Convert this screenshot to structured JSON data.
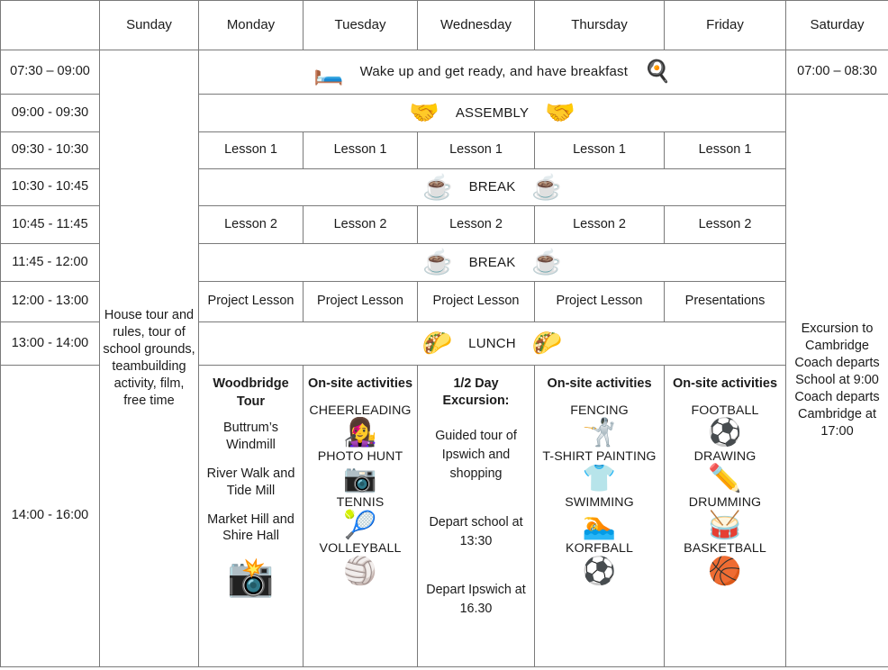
{
  "table": {
    "corner_label": "",
    "days": [
      "Sunday",
      "Monday",
      "Tuesday",
      "Wednesday",
      "Thursday",
      "Friday",
      "Saturday"
    ],
    "times": [
      "07:30 – 09:00",
      "09:00 - 09:30",
      "09:30 - 10:30",
      "10:30 - 10:45",
      "10:45 - 11:45",
      "11:45 - 12:00",
      "12:00 - 13:00",
      "13:00 - 14:00",
      "14:00 - 16:00"
    ],
    "saturday_morning_time": "07:00 – 08:30"
  },
  "rows": {
    "wakeup": {
      "text": "Wake up and get ready, and have breakfast",
      "left_icon": "person-in-bed-icon",
      "left_emoji": "🛏️",
      "right_icon": "breakfast-plate-icon",
      "right_emoji": "🍳"
    },
    "assembly": {
      "text": "ASSEMBLY",
      "left_icon": "people-group-icon",
      "left_emoji": "🤝",
      "right_icon": "people-group-icon",
      "right_emoji": "🤝"
    },
    "lesson1": [
      "Lesson 1",
      "Lesson 1",
      "Lesson 1",
      "Lesson 1",
      "Lesson 1"
    ],
    "break1": {
      "text": "BREAK",
      "left_icon": "coffee-cup-icon",
      "left_emoji": "☕",
      "right_icon": "coffee-cup-icon",
      "right_emoji": "☕"
    },
    "lesson2": [
      "Lesson 2",
      "Lesson 2",
      "Lesson 2",
      "Lesson 2",
      "Lesson 2"
    ],
    "break2": {
      "text": "BREAK",
      "left_icon": "coffee-cup-icon",
      "left_emoji": "☕",
      "right_icon": "coffee-cup-icon",
      "right_emoji": "☕"
    },
    "project": [
      "Project Lesson",
      "Project Lesson",
      "Project Lesson",
      "Project Lesson",
      "Presentations"
    ],
    "lunch": {
      "text": "LUNCH",
      "left_icon": "taco-icon",
      "left_emoji": "🌮",
      "right_icon": "taco-icon",
      "right_emoji": "🌮"
    }
  },
  "sunday": {
    "text": "House tour and rules, tour of school grounds, teambuilding activity, film, free time"
  },
  "afternoon": {
    "monday": {
      "header": "Woodbridge Tour",
      "items": [
        "Buttrum’s Windmill",
        "River Walk and Tide Mill",
        "Market Hill and Shire Hall"
      ],
      "icon": "photo-camera-globe-icon",
      "icon_emoji": "📸"
    },
    "tuesday": {
      "header": "On-site activities",
      "items": [
        {
          "label": "CHEERLEADING",
          "icon": "cheerleading-icon",
          "emoji": "👩‍🎤"
        },
        {
          "label": "PHOTO HUNT",
          "icon": "camera-icon",
          "emoji": "📷"
        },
        {
          "label": "TENNIS",
          "icon": "tennis-racket-icon",
          "emoji": "🎾"
        },
        {
          "label": "VOLLEYBALL",
          "icon": "volleyball-icon",
          "emoji": "🏐"
        }
      ]
    },
    "wednesday": {
      "header": "1/2 Day Excursion:",
      "description": "Guided tour of Ipswich and shopping",
      "depart_school": "Depart school at 13:30",
      "depart_ipswich": "Depart Ipswich at 16.30"
    },
    "thursday": {
      "header": "On-site activities",
      "items": [
        {
          "label": "FENCING",
          "icon": "fencing-icon",
          "emoji": "🤺"
        },
        {
          "label": "T-SHIRT PAINTING",
          "icon": "tshirt-paint-icon",
          "emoji": "👕"
        },
        {
          "label": "SWIMMING",
          "icon": "swimmer-icon",
          "emoji": "🏊"
        },
        {
          "label": "KORFBALL",
          "icon": "korfball-icon",
          "emoji": "⚽"
        }
      ]
    },
    "friday": {
      "header": "On-site activities",
      "items": [
        {
          "label": "FOOTBALL",
          "icon": "football-boot-icon",
          "emoji": "⚽"
        },
        {
          "label": "DRAWING",
          "icon": "drawing-hand-icon",
          "emoji": "✏️"
        },
        {
          "label": "DRUMMING",
          "icon": "djembe-drum-icon",
          "emoji": "🥁"
        },
        {
          "label": "BASKETBALL",
          "icon": "basketball-icon",
          "emoji": "🏀"
        }
      ]
    }
  },
  "saturday": {
    "text": "Excursion to Cambridge Coach departs School at 9:00 Coach departs Cambridge at 17:00"
  }
}
